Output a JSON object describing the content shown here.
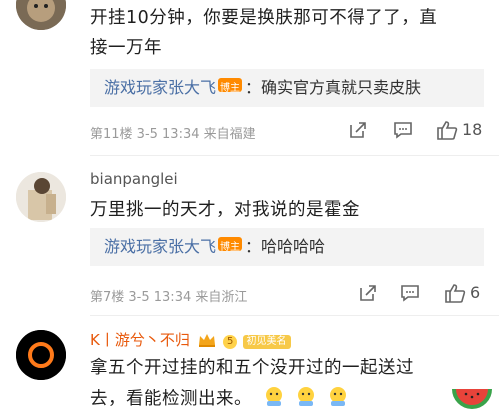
{
  "comments": [
    {
      "text_line1": "开挂10分钟，你要是换肤那可不得了了，直",
      "text_line2": "接一万年",
      "reply_user": "游戏玩家张大飞",
      "reply_badge": "博主",
      "reply_text": "：确实官方真就只卖皮肤",
      "meta": "第11楼  3-5 13:34  来自福建",
      "likes": "18"
    },
    {
      "username": "bianpanglei",
      "text_line1": "万里挑一的天才，对我说的是霍金",
      "reply_user": "游戏玩家张大飞",
      "reply_badge": "博主",
      "reply_text": "：哈哈哈哈",
      "meta": "第7楼  3-5 13:34  来自浙江",
      "likes": "6"
    },
    {
      "username": "K丨游兮丶不归",
      "level": "5",
      "fan_badge": "初见美名",
      "text_line1": "拿五个开过挂的和五个没开过的一起送过",
      "text_line2": "去，看能检测出来。"
    }
  ],
  "icons": [
    "share-icon",
    "comment-icon",
    "like-icon",
    "crown-icon",
    "emoji-icon",
    "watermelon-sticker-icon"
  ],
  "colors": {
    "link_blue": "#4a6fa5",
    "badge_orange": "#ff8a00",
    "reply_bg": "#f3f3f3",
    "meta_gray": "#9a9a9a",
    "name_orange": "#e8590c",
    "fan_badge_yellow": "#f7c948"
  }
}
